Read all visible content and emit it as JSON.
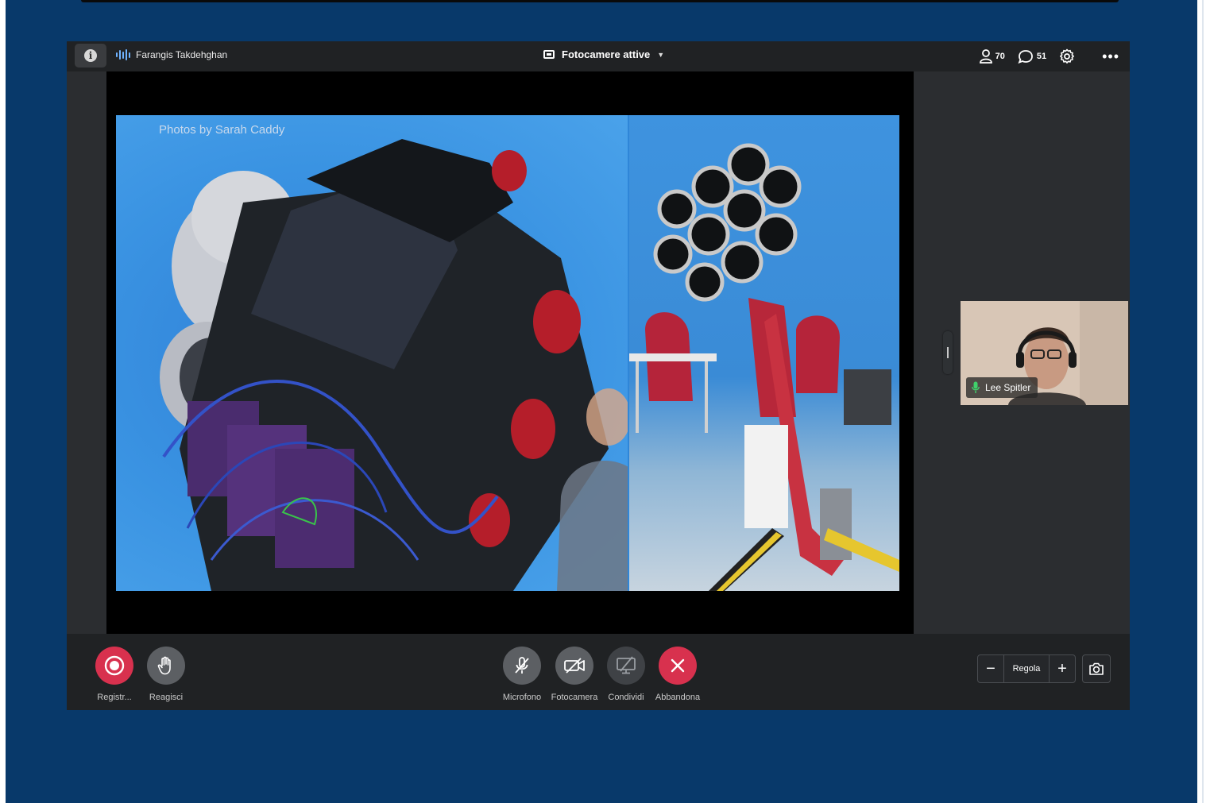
{
  "topbar": {
    "speaker_name": "Farangis Takdehghan",
    "view_label": "Fotocamere attive",
    "participants_count": "70",
    "chat_count": "51"
  },
  "slide": {
    "credit": "Photos by Sarah Caddy"
  },
  "participant_tile": {
    "name": "Lee Spitler"
  },
  "controls": {
    "record": "Registr...",
    "react": "Reagisci",
    "microphone": "Microfono",
    "camera": "Fotocamera",
    "share": "Condividi",
    "leave": "Abbandona"
  },
  "zoom": {
    "label": "Regola",
    "minus": "−",
    "plus": "+"
  },
  "colors": {
    "page_background": "#08396a",
    "record_red": "#d8314e",
    "leave_red": "#d8314e",
    "mic_active_green": "#3fd16b"
  }
}
